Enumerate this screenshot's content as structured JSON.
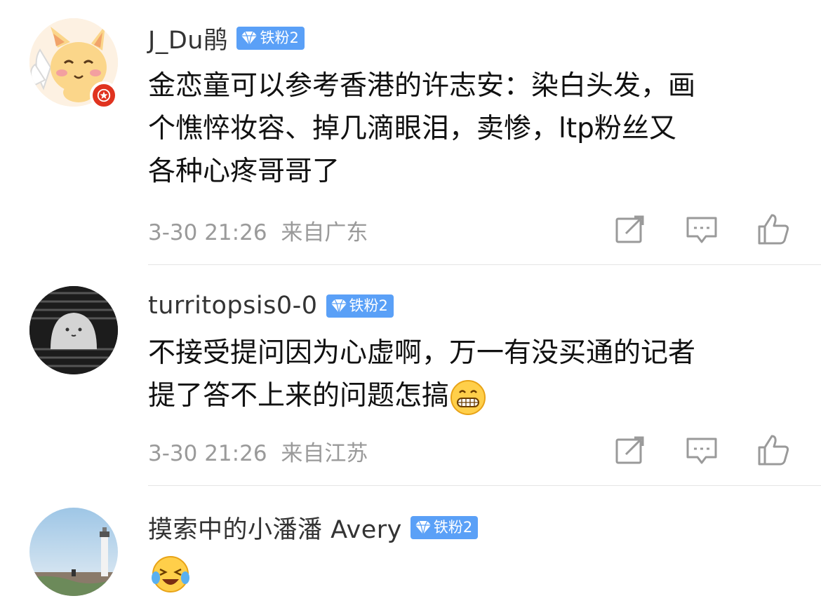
{
  "comments": [
    {
      "username": "J_Du鹃",
      "badge": "铁粉2",
      "lines": [
        "金恋童可以参考香港的许志安：染白头发，画",
        "个憔悴妆容、掉几滴眼泪，卖惨，ltp粉丝又",
        "各种心疼哥哥了"
      ],
      "time": "3-30 21:26",
      "location": "来自广东",
      "avatar_icon": "cartoon-cat-avatar",
      "verified_icon": "star-verified-icon"
    },
    {
      "username": "turritopsis0-0",
      "badge": "铁粉2",
      "lines": [
        "不接受提问因为心虚啊，万一有没买通的记者",
        "提了答不上来的问题怎搞"
      ],
      "time": "3-30 21:26",
      "location": "来自江苏",
      "avatar_icon": "ghost-avatar",
      "emoji": "grin-emoji"
    },
    {
      "username": "摸索中的小潘潘 Avery",
      "badge": "铁粉2",
      "avatar_icon": "lighthouse-avatar",
      "emoji": "laugh-cry-emoji"
    }
  ],
  "colors": {
    "badge": "#5aa0f7",
    "meta": "#9a9a9a",
    "text": "#111111",
    "verified": "#e0331f"
  }
}
